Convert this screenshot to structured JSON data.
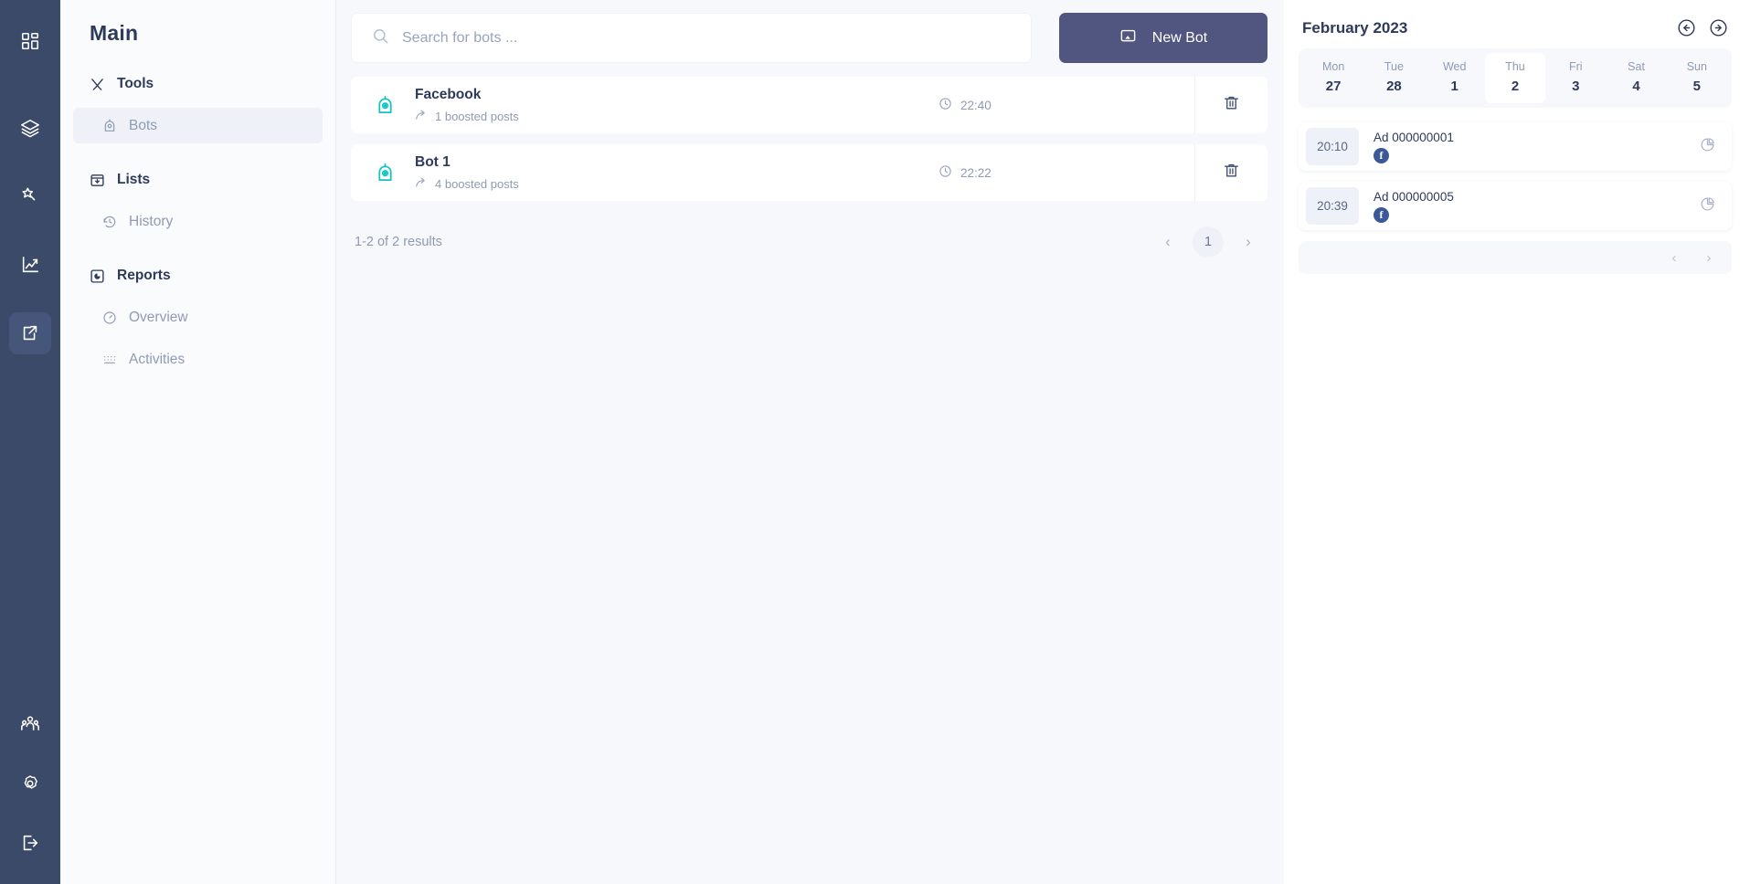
{
  "rail": {
    "items": [
      {
        "icon": "dashboard-grid-icon",
        "active": false
      },
      {
        "icon": "layers-icon",
        "active": false
      },
      {
        "icon": "magic-wand-icon",
        "active": false
      },
      {
        "icon": "analytics-chart-icon",
        "active": false
      },
      {
        "icon": "share-export-icon",
        "active": true
      }
    ],
    "bottom_items": [
      {
        "icon": "users-group-icon",
        "active": false
      },
      {
        "icon": "gear-settings-icon",
        "active": false
      },
      {
        "icon": "logout-icon",
        "active": false
      }
    ]
  },
  "sidebar": {
    "title": "Main",
    "groups": [
      {
        "label": "Tools",
        "icon": "tools-icon",
        "items": [
          {
            "label": "Bots",
            "icon": "robot-icon",
            "active": true
          }
        ]
      },
      {
        "label": "Lists",
        "icon": "inbox-download-icon",
        "items": [
          {
            "label": "History",
            "icon": "history-clock-icon",
            "active": false
          }
        ]
      },
      {
        "label": "Reports",
        "icon": "pie-report-icon",
        "items": [
          {
            "label": "Overview",
            "icon": "gauge-icon",
            "active": false
          },
          {
            "label": "Activities",
            "icon": "grid-dots-icon",
            "active": false
          }
        ]
      }
    ]
  },
  "main": {
    "search": {
      "placeholder": "Search for bots ...",
      "value": "",
      "icon": "search-icon"
    },
    "new_bot_button": {
      "label": "New Bot",
      "icon": "new-bot-screen-icon"
    },
    "bots": [
      {
        "name": "Facebook",
        "boosted": "1 boosted posts",
        "time": "22:40",
        "icon": "robot-icon",
        "boost_icon": "share-arrow-icon",
        "time_icon": "clock-icon",
        "delete_icon": "trash-icon"
      },
      {
        "name": "Bot 1",
        "boosted": "4 boosted posts",
        "time": "22:22",
        "icon": "robot-icon",
        "boost_icon": "share-arrow-icon",
        "time_icon": "clock-icon",
        "delete_icon": "trash-icon"
      }
    ],
    "pagination": {
      "results_text": "1-2 of 2 results",
      "prev": "‹",
      "page": "1",
      "next": "›"
    }
  },
  "right_panel": {
    "calendar_title": "February 2023",
    "prev_icon": "arrow-left-circle-icon",
    "next_icon": "arrow-right-circle-icon",
    "days": [
      {
        "name": "Mon",
        "num": "27",
        "active": false
      },
      {
        "name": "Tue",
        "num": "28",
        "active": false
      },
      {
        "name": "Wed",
        "num": "1",
        "active": false
      },
      {
        "name": "Thu",
        "num": "2",
        "active": true
      },
      {
        "name": "Fri",
        "num": "3",
        "active": false
      },
      {
        "name": "Sat",
        "num": "4",
        "active": false
      },
      {
        "name": "Sun",
        "num": "5",
        "active": false
      }
    ],
    "events": [
      {
        "time": "20:10",
        "title": "Ad 000000001",
        "network": "f",
        "network_name": "facebook-icon",
        "chart_icon": "pie-chart-icon"
      },
      {
        "time": "20:39",
        "title": "Ad 000000005",
        "network": "f",
        "network_name": "facebook-icon",
        "chart_icon": "pie-chart-icon"
      }
    ],
    "pagination": {
      "prev": "‹",
      "next": "›"
    }
  },
  "colors": {
    "rail_bg": "#3b4a68",
    "rail_active": "#46567a",
    "accent_button": "#50567f",
    "bot_icon": "#10c4c4",
    "text_dark": "#2e3a59",
    "text_muted": "#8f9bb3",
    "panel_bg": "#f7f8fc",
    "facebook_blue": "#3b5998"
  }
}
